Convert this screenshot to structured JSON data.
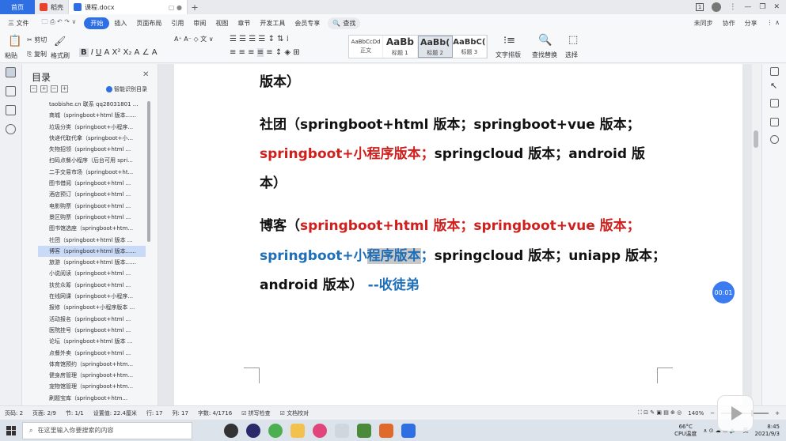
{
  "titlebar": {
    "home": "首页",
    "tab1": "稻壳",
    "tab2": "课程.docx",
    "new_tab": "+",
    "badge": "1"
  },
  "menu": {
    "file": "三 文件",
    "items": [
      "开始",
      "插入",
      "页面布局",
      "引用",
      "审阅",
      "视图",
      "章节",
      "开发工具",
      "会员专享"
    ],
    "search": "查找",
    "right": [
      "未同步",
      "协作",
      "分享"
    ]
  },
  "ribbon": {
    "paste": "粘贴",
    "cut": "剪切",
    "copy": "复制",
    "format_painter": "格式刷",
    "font": "黑体",
    "size": "三号",
    "styles": [
      {
        "preview": "AaBbCcDd",
        "label": "正文"
      },
      {
        "preview": "AaBb",
        "label": "标题 1"
      },
      {
        "preview": "AaBb(",
        "label": "标题 2"
      },
      {
        "preview": "AaBbC(",
        "label": "标题 3"
      }
    ],
    "text_layout": "文字排版",
    "find_replace": "查找替换",
    "select": "选择"
  },
  "toc": {
    "title": "目录",
    "smart": "智能识别目录",
    "items": [
      "taobishe.cn 联系 qq28031801 ...",
      "商城（springboot+html 版本......",
      "垃圾分类（springboot+小程序...",
      "快递代取代拿（springboot+小...",
      "失物招领（springboot+html ...",
      "扫码点餐小程序（后台可用 spri...",
      "二手交易市场（springboot+ht...",
      "图书借阅（springboot+html ...",
      "酒店预订（springboot+html ...",
      "电影购票（springboot+html ...",
      "景区购票（springboot+html ...",
      "图书馆选座（springboot+htm...",
      "社团（springboot+html 版本 ...",
      "博客（springboot+html 版本......",
      "旅游（springboot+html 版本......",
      "小说阅读（springboot+html ...",
      "扶贫众筹（springboot+html ...",
      "在线网课（springboot+小程序...",
      "报修（springboot+小程序版本 ...",
      "活动报名（springboot+html ...",
      "医院挂号（springboot+html ...",
      "论坛（springboot+html 版本 ...",
      "点餐外卖（springboot+html ...",
      "体育馆预约（springboot+htm...",
      "健身房管理（springboot+htm...",
      "宠物馆管理（springboot+htm...",
      "刷题宝库（springboot+htm..."
    ],
    "selected_index": 13
  },
  "document": {
    "line0": "版本）",
    "club_prefix": "社团（",
    "club_p1": "springboot+html 版本；springboot+vue 版本；",
    "club_red": "springboot+小程序版本；",
    "club_p2": "springcloud 版本；android 版",
    "club_p3": "本）",
    "blog_prefix": "博客（",
    "blog_red": "springboot+html 版本；springboot+vue 版本；",
    "blog_blue1": "springboot+小",
    "blog_blue_hl": "程序版本",
    "blog_blue2": "；",
    "blog_black": "springcloud 版本；uniapp 版本；",
    "blog_last_black": "android 版本）",
    "blog_last_blue": "--收徒弟"
  },
  "timer": "00:01",
  "status": {
    "page": "页码: 2",
    "pages": "页面: 2/9",
    "section": "节: 1/1",
    "setting": "设置值: 22.4厘米",
    "row": "行: 17",
    "col": "列: 17",
    "words": "字数: 4/1716",
    "spell": "拼写检查",
    "proof": "文档校对",
    "zoom": "140%"
  },
  "taskbar": {
    "search_placeholder": "在这里输入你要搜索的内容",
    "temp": "66°C",
    "temp_label": "CPU温度",
    "lang": "英",
    "time": "8:45",
    "date": "2021/9/3"
  }
}
